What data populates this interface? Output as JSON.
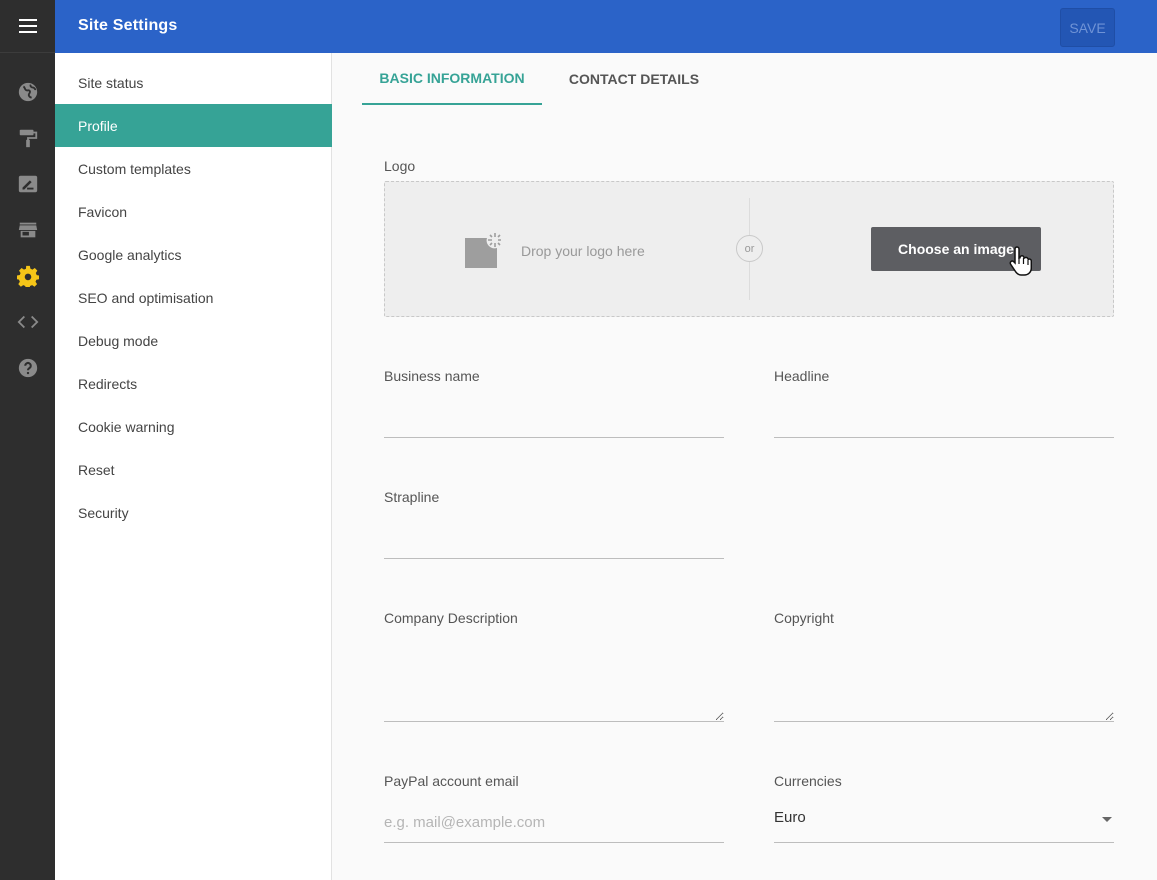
{
  "app": {
    "title": "Site Settings",
    "save_label": "SAVE"
  },
  "rail": {
    "icons": [
      "globe-icon",
      "paint-roller-icon",
      "edit-icon",
      "store-icon",
      "gear-icon",
      "code-icon",
      "help-icon"
    ],
    "active_icon": "gear-icon",
    "active_color": "#f5c518"
  },
  "nav": {
    "items": [
      {
        "label": "Site status"
      },
      {
        "label": "Profile"
      },
      {
        "label": "Custom templates"
      },
      {
        "label": "Favicon"
      },
      {
        "label": "Google analytics"
      },
      {
        "label": "SEO and optimisation"
      },
      {
        "label": "Debug mode"
      },
      {
        "label": "Redirects"
      },
      {
        "label": "Cookie warning"
      },
      {
        "label": "Reset"
      },
      {
        "label": "Security"
      }
    ],
    "active": "Profile"
  },
  "tabs": [
    {
      "label": "BASIC INFORMATION"
    },
    {
      "label": "CONTACT DETAILS"
    }
  ],
  "form": {
    "logo": {
      "label": "Logo",
      "drop_text": "Drop your logo here",
      "or_text": "or",
      "choose_label": "Choose an image"
    },
    "business_name": {
      "label": "Business name",
      "value": ""
    },
    "headline": {
      "label": "Headline",
      "value": ""
    },
    "strapline": {
      "label": "Strapline",
      "value": ""
    },
    "company_description": {
      "label": "Company Description",
      "value": ""
    },
    "copyright": {
      "label": "Copyright",
      "value": ""
    },
    "paypal_email": {
      "label": "PayPal account email",
      "placeholder": "e.g. mail@example.com",
      "value": ""
    },
    "currencies": {
      "label": "Currencies",
      "value": "Euro"
    }
  },
  "colors": {
    "header": "#2b63c8",
    "accent": "#36a396",
    "rail": "#2e2e2e"
  }
}
